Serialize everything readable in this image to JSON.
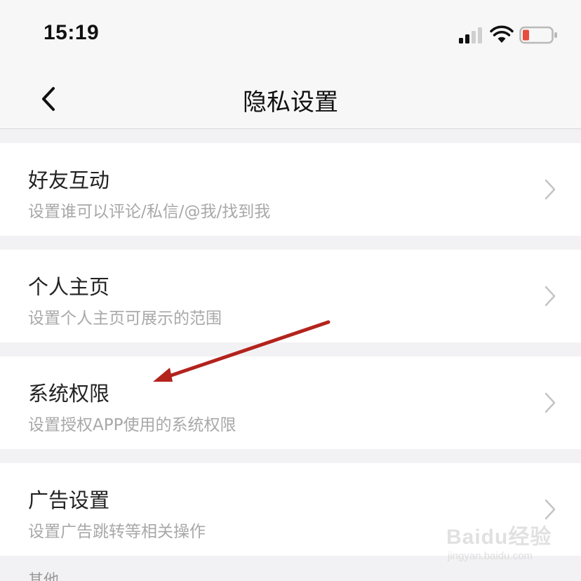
{
  "status_bar": {
    "time": "15:19",
    "icons": [
      "signal-icon",
      "wifi-icon",
      "battery-icon"
    ],
    "battery_color": "#e74c3c"
  },
  "nav": {
    "title": "隐私设置",
    "back_icon": "chevron-left-icon"
  },
  "items": [
    {
      "title": "好友互动",
      "subtitle": "设置谁可以评论/私信/@我/找到我"
    },
    {
      "title": "个人主页",
      "subtitle": "设置个人主页可展示的范围"
    },
    {
      "title": "系统权限",
      "subtitle": "设置授权APP使用的系统权限"
    },
    {
      "title": "广告设置",
      "subtitle": "设置广告跳转等相关操作"
    }
  ],
  "next_section_peek": "其他",
  "annotation_color": "#b3231c",
  "watermark": {
    "brand": "Baidu经验",
    "url": "jingyan.baidu.com"
  }
}
